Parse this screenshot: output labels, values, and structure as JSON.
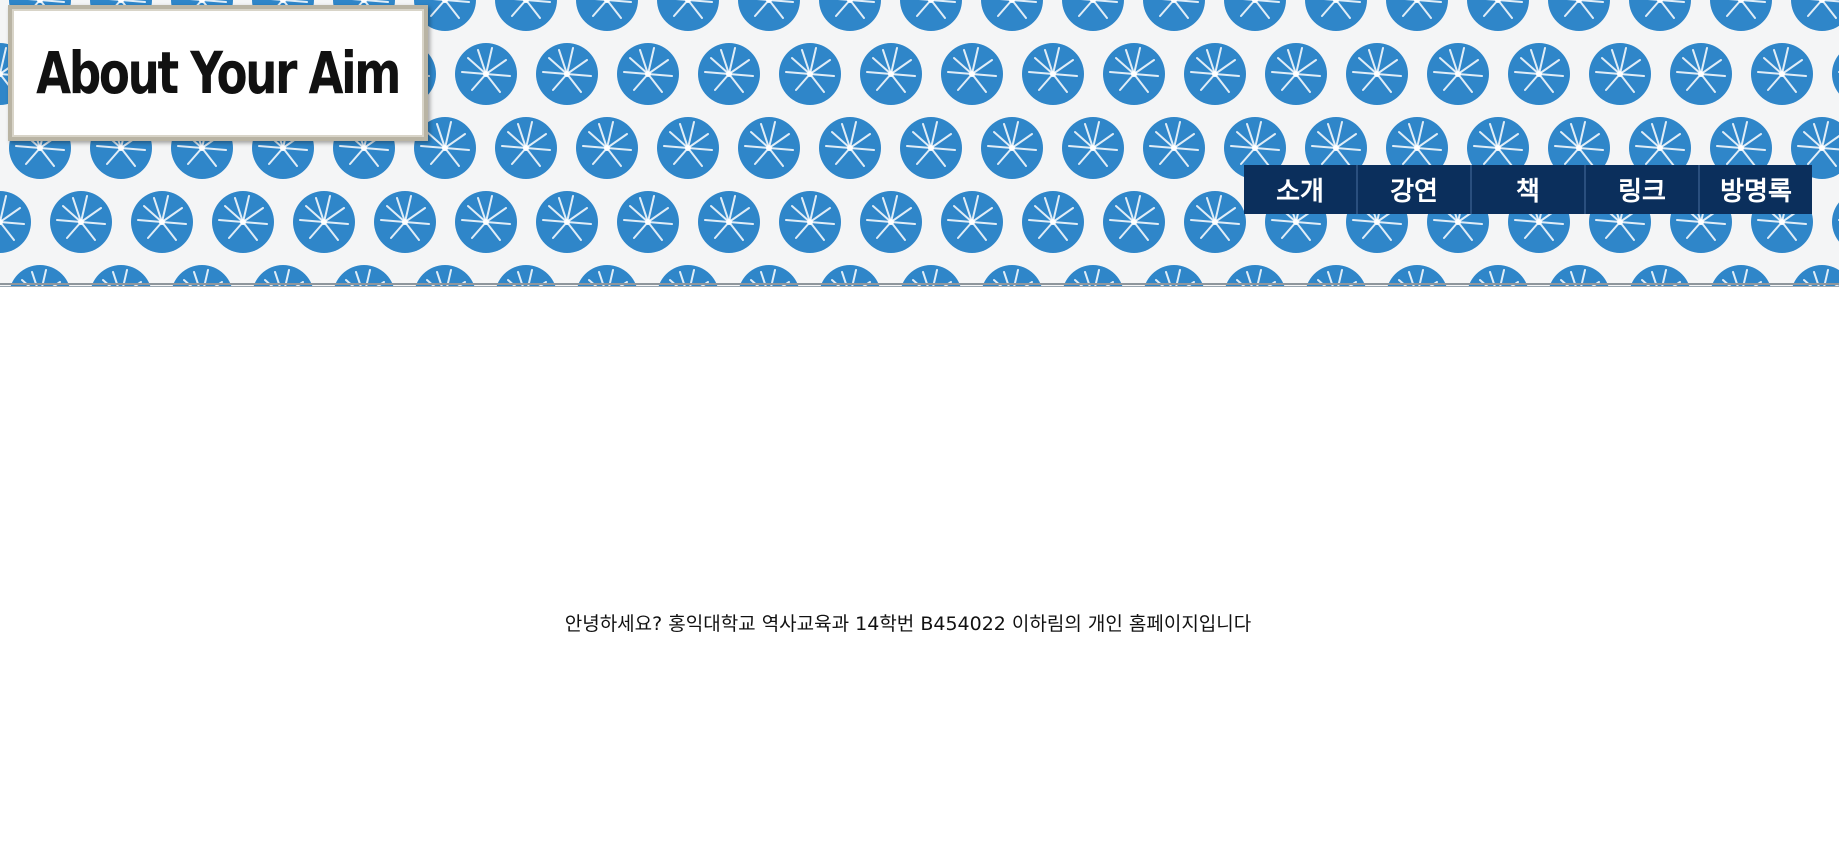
{
  "site": {
    "title": "About Your Aim"
  },
  "nav": {
    "items": [
      {
        "label": "소개"
      },
      {
        "label": "강연"
      },
      {
        "label": "책"
      },
      {
        "label": "링크"
      },
      {
        "label": "방명록"
      }
    ]
  },
  "main": {
    "greeting": "안녕하세요? 홍익대학교 역사교육과 14학번 B454022 이하림의 개인 홈페이지입니다"
  },
  "colors": {
    "header_background": "#f4f5f6",
    "pattern_dot": "#2f86c9",
    "nav_background": "#0b2f5c",
    "nav_text": "#ffffff",
    "logo_frame": "#b9b4a4"
  }
}
